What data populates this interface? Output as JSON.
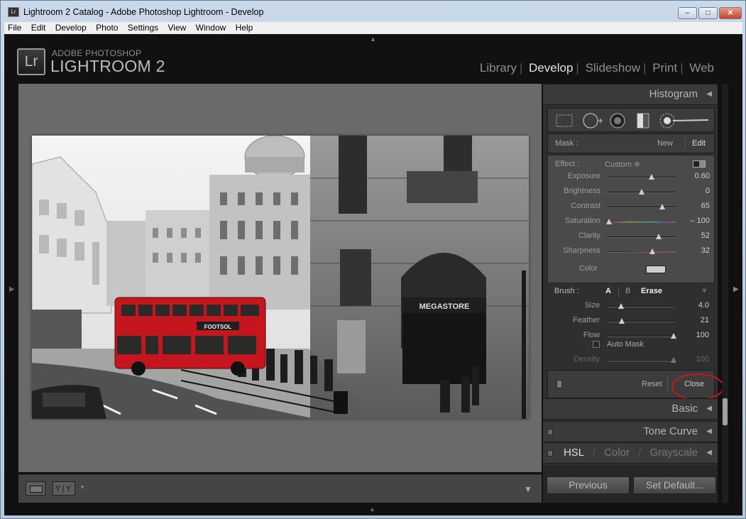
{
  "window": {
    "title": "Lightroom 2 Catalog - Adobe Photoshop Lightroom - Develop",
    "app_icon": "Lr",
    "min": "–",
    "max": "□",
    "close": "✕"
  },
  "menu": [
    "File",
    "Edit",
    "Develop",
    "Photo",
    "Settings",
    "View",
    "Window",
    "Help"
  ],
  "brand": {
    "logo": "Lr",
    "top": "ADOBE PHOTOSHOP",
    "main": "LIGHTROOM 2"
  },
  "modules": {
    "items": [
      "Library",
      "Develop",
      "Slideshow",
      "Print",
      "Web"
    ],
    "active": "Develop",
    "separator": "|"
  },
  "panels": {
    "histogram": "Histogram",
    "basic": "Basic",
    "tone_curve": "Tone Curve",
    "hsl": {
      "hsl": "HSL",
      "color": "Color",
      "grayscale": "Grayscale",
      "sep": "/"
    }
  },
  "mask": {
    "label": "Mask :",
    "new": "New",
    "edit": "Edit"
  },
  "effect": {
    "label": "Effect :",
    "preset": "Custom ≑"
  },
  "sliders": [
    {
      "label": "Exposure",
      "value": "0.60",
      "level": 0.65
    },
    {
      "label": "Brightness",
      "value": "0",
      "level": 0.5
    },
    {
      "label": "Contrast",
      "value": "65",
      "level": 0.82
    },
    {
      "label": "Saturation",
      "value": "– 100",
      "level": 0.0
    },
    {
      "label": "Clarity",
      "value": "52",
      "level": 0.76
    },
    {
      "label": "Sharpness",
      "value": "32",
      "level": 0.66
    }
  ],
  "color_label": "Color",
  "brush": {
    "label": "Brush :",
    "a": "A",
    "b": "B",
    "erase": "Erase",
    "sliders": [
      {
        "label": "Size",
        "value": "4.0",
        "level": 0.2
      },
      {
        "label": "Feather",
        "value": "21",
        "level": 0.21
      },
      {
        "label": "Flow",
        "value": "100",
        "level": 1.0
      }
    ],
    "auto_mask": "Auto Mask",
    "density": {
      "label": "Density",
      "value": "100",
      "level": 1.0
    }
  },
  "actions": {
    "reset": "Reset",
    "close": "Close"
  },
  "bottom_buttons": {
    "previous": "Previous",
    "set_default": "Set Default..."
  },
  "toolbar": {
    "before_after": "Y|Y"
  },
  "photo": {
    "sign": "MEGASTORE",
    "bus_ad": "FOOTSOL"
  },
  "colors": {
    "highlight": "#d01515",
    "bus": "#c4161c",
    "accent": "#e4e4e4"
  }
}
